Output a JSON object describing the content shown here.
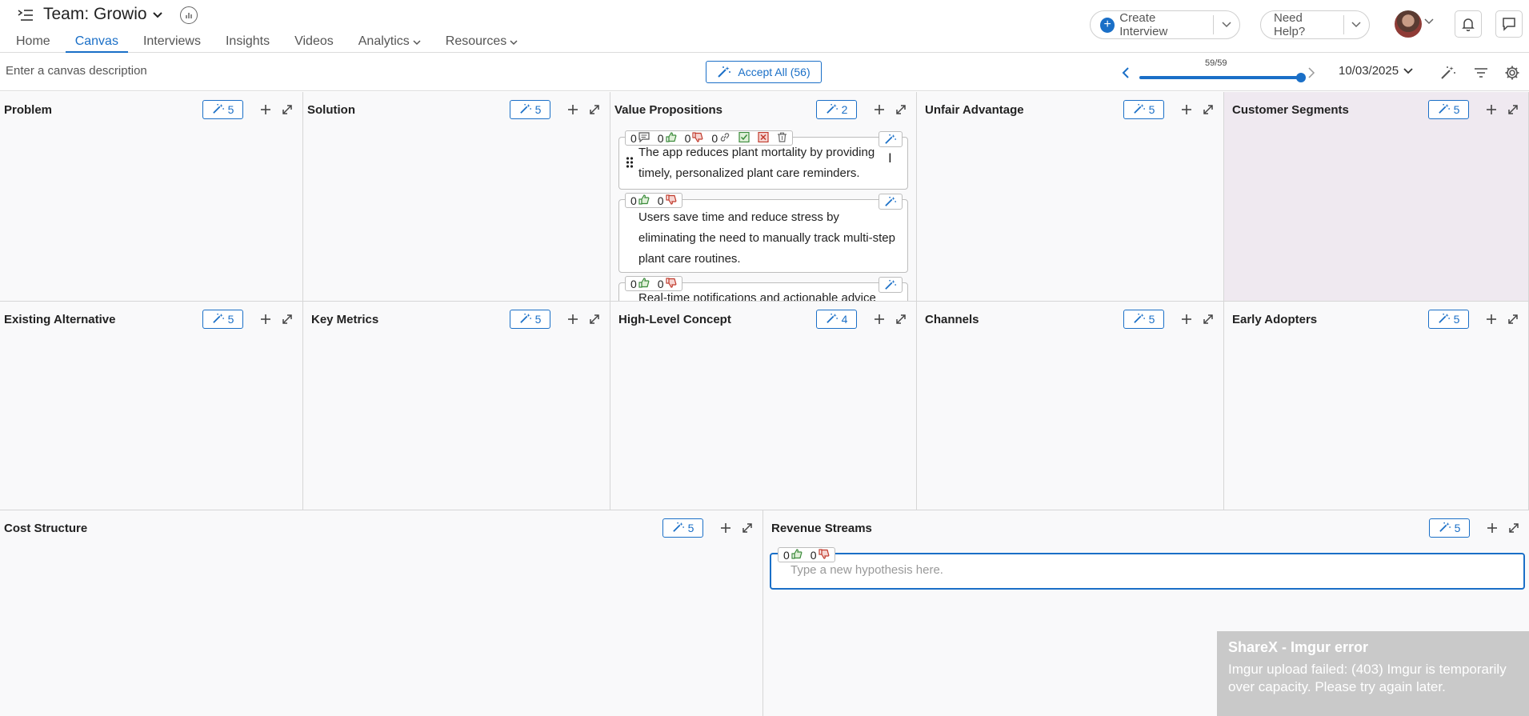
{
  "header": {
    "team_title": "Team: Growio",
    "nav": [
      {
        "label": "Home"
      },
      {
        "label": "Canvas"
      },
      {
        "label": "Interviews"
      },
      {
        "label": "Insights"
      },
      {
        "label": "Videos"
      },
      {
        "label": "Analytics"
      },
      {
        "label": "Resources"
      }
    ],
    "active_tab": "Canvas",
    "create_label": "Create Interview",
    "help_label": "Need Help?"
  },
  "toolbar": {
    "description_placeholder": "Enter a canvas description",
    "accept_all_label": "Accept All (56)",
    "slider": {
      "count_label": "59/59",
      "current": 59,
      "total": 59
    },
    "date": "10/03/2025"
  },
  "canvas": {
    "problem": {
      "title": "Problem",
      "ai_count": "5"
    },
    "solution": {
      "title": "Solution",
      "ai_count": "5"
    },
    "value_propositions": {
      "title": "Value Propositions",
      "ai_count": "2"
    },
    "unfair_advantage": {
      "title": "Unfair Advantage",
      "ai_count": "5"
    },
    "customer_segments": {
      "title": "Customer Segments",
      "ai_count": "5"
    },
    "existing_alternative": {
      "title": "Existing Alternative",
      "ai_count": "5"
    },
    "key_metrics": {
      "title": "Key Metrics",
      "ai_count": "5"
    },
    "high_level_concept": {
      "title": "High-Level Concept",
      "ai_count": "4"
    },
    "channels": {
      "title": "Channels",
      "ai_count": "5"
    },
    "early_adopters": {
      "title": "Early Adopters",
      "ai_count": "5"
    },
    "cost_structure": {
      "title": "Cost Structure",
      "ai_count": "5"
    },
    "revenue_streams": {
      "title": "Revenue Streams",
      "ai_count": "5"
    }
  },
  "value_prop_cards": [
    {
      "text": "The app reduces plant mortality by providing timely, personalized plant care reminders.",
      "comments": "0",
      "likes": "0",
      "dislikes": "0",
      "links": "0"
    },
    {
      "text": "Users save time and reduce stress by eliminating the need to manually track multi-step plant care routines.",
      "likes": "0",
      "dislikes": "0"
    },
    {
      "text": "Real-time notifications and actionable advice",
      "likes": "0",
      "dislikes": "0"
    }
  ],
  "new_hypothesis": {
    "placeholder": "Type a new hypothesis here.",
    "likes": "0",
    "dislikes": "0"
  },
  "toast": {
    "title": "ShareX - Imgur error",
    "message": "Imgur upload failed: (403) Imgur is temporarily over capacity. Please try again later."
  },
  "colors": {
    "accent": "#1a6fc7",
    "highlight_cell": "#efe9f0",
    "toast_bg": "#c9c9c9"
  },
  "icons": [
    "menu-toggle-icon",
    "chevron-down-icon",
    "stats-icon",
    "plus-circle-icon",
    "bell-icon",
    "chat-icon",
    "magic-wand-icon",
    "chevron-left-icon",
    "chevron-right-icon",
    "filter-icon",
    "gear-icon",
    "plus-icon",
    "expand-icon",
    "comment-icon",
    "thumbs-up-icon",
    "thumbs-down-icon",
    "link-icon",
    "accept-icon",
    "reject-icon",
    "trash-icon",
    "drag-handle-icon"
  ]
}
